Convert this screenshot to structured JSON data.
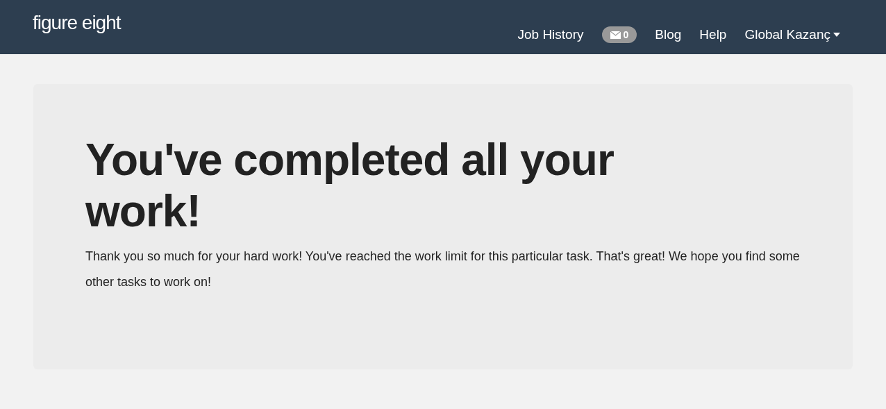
{
  "header": {
    "logo": "figure eight",
    "nav": [
      {
        "kind": "link",
        "label": "Job History"
      },
      {
        "kind": "badge",
        "label": "0"
      },
      {
        "kind": "link",
        "label": "Blog"
      },
      {
        "kind": "link",
        "label": "Help"
      },
      {
        "kind": "dropdown",
        "label": "Global Kazanç"
      }
    ]
  },
  "card": {
    "title": "You've completed all your work!",
    "message": "Thank you so much for your hard work! You've reached the work limit for this particular task. That's great! We hope you find some other tasks to work on!"
  }
}
